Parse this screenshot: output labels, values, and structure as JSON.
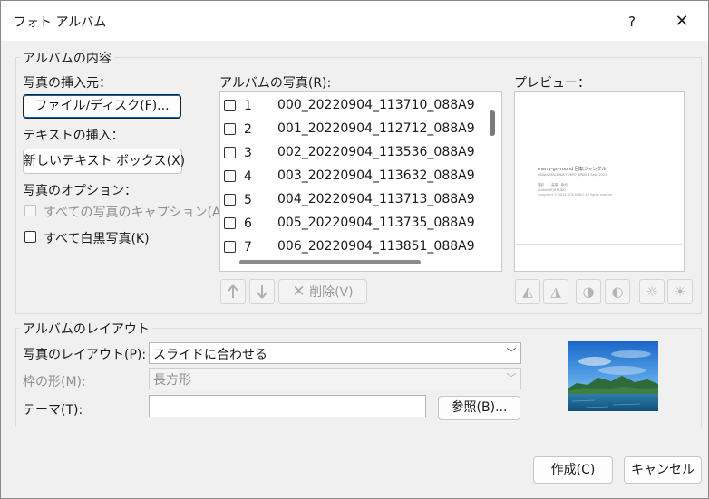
{
  "window": {
    "title": "フォト アルバム",
    "help": "?",
    "close": "✕"
  },
  "content_group": {
    "title": "アルバムの内容",
    "insert_from_label": "写真の挿入元：",
    "file_disk_button": "ファイル/ディスク(F)...",
    "insert_text_label": "テキストの挿入：",
    "new_textbox_button": "新しいテキスト ボックス(X)",
    "photo_options_label": "写真のオプション：",
    "caption_all_label": "すべての写真のキャプション(A)",
    "all_bw_label": "すべて白黒写真(K)"
  },
  "photo_list": {
    "label": "アルバムの写真(R):",
    "items": [
      {
        "num": "1",
        "name": "000_20220904_113710_088A9"
      },
      {
        "num": "2",
        "name": "001_20220904_112712_088A9"
      },
      {
        "num": "3",
        "name": "002_20220904_113536_088A9"
      },
      {
        "num": "4",
        "name": "003_20220904_113632_088A9"
      },
      {
        "num": "5",
        "name": "004_20220904_113713_088A9"
      },
      {
        "num": "6",
        "name": "005_20220904_113735_088A9"
      },
      {
        "num": "7",
        "name": "006_20220904_113851_088A9"
      }
    ],
    "up_icon": "arrow-up-icon",
    "down_icon": "arrow-down-icon",
    "delete_button": "削除(V)"
  },
  "preview": {
    "label": "プレビュー：",
    "slide_title": "merry-go-round 回転ジャングル",
    "slide_sub": "OSAKA MACHIDA TOKYO JAPAN 4 Sept 2021",
    "slide_meta1": "撮影　　  高橋　幸司",
    "slide_meta2": "Author   KOJI SUDO",
    "slide_copyright": "Copyright  ©  2022 KOJI SUDO All rights reserve",
    "tool_icons": [
      "rotate-left-icon",
      "rotate-right-icon",
      "contrast-up-icon",
      "contrast-down-icon",
      "brightness-up-icon",
      "brightness-down-icon"
    ]
  },
  "layout_group": {
    "title": "アルバムのレイアウト",
    "photo_layout_label": "写真のレイアウト(P):",
    "photo_layout_value": "スライドに合わせる",
    "frame_label": "枠の形(M):",
    "frame_value": "長方形",
    "theme_label": "テーマ(T):",
    "theme_value": "",
    "browse_button": "参照(B)..."
  },
  "footer": {
    "create_button": "作成(C)",
    "cancel_button": "キャンセル"
  }
}
